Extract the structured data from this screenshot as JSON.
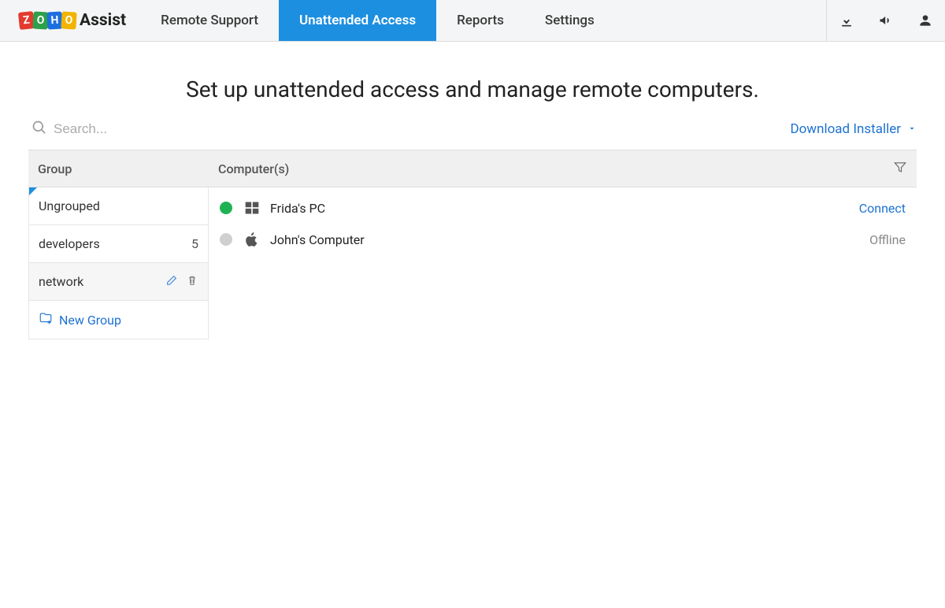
{
  "brand": {
    "zoho": [
      "Z",
      "O",
      "H",
      "O"
    ],
    "product": "Assist"
  },
  "nav": {
    "items": [
      {
        "label": "Remote Support",
        "active": false
      },
      {
        "label": "Unattended Access",
        "active": true
      },
      {
        "label": "Reports",
        "active": false
      },
      {
        "label": "Settings",
        "active": false
      }
    ]
  },
  "heading": "Set up unattended access and manage remote computers.",
  "search": {
    "placeholder": "Search..."
  },
  "download_link": "Download Installer",
  "table": {
    "group_header": "Group",
    "computers_header": "Computer(s)"
  },
  "groups": [
    {
      "name": "Ungrouped",
      "count": "",
      "active": true
    },
    {
      "name": "developers",
      "count": "5"
    },
    {
      "name": "network",
      "hovered": true
    },
    {
      "new": true,
      "label": "New Group"
    }
  ],
  "computers": [
    {
      "name": "Frida's PC",
      "os": "windows",
      "status": "online",
      "action": "Connect"
    },
    {
      "name": "John's Computer",
      "os": "apple",
      "status": "offline",
      "action": "Offline"
    }
  ]
}
